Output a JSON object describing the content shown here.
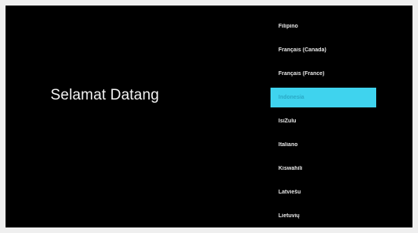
{
  "screen": {
    "welcome_text": "Selamat Datang",
    "selection_color": "#3fd3ee"
  },
  "languages": {
    "items": [
      {
        "label": "Filipino",
        "selected": false
      },
      {
        "label": "Français (Canada)",
        "selected": false
      },
      {
        "label": "Français (France)",
        "selected": false
      },
      {
        "label": "Indonesia",
        "selected": true
      },
      {
        "label": "IsiZulu",
        "selected": false
      },
      {
        "label": "Italiano",
        "selected": false
      },
      {
        "label": "Kiswahili",
        "selected": false
      },
      {
        "label": "Latviešu",
        "selected": false
      },
      {
        "label": "Lietuvių",
        "selected": false
      }
    ]
  }
}
